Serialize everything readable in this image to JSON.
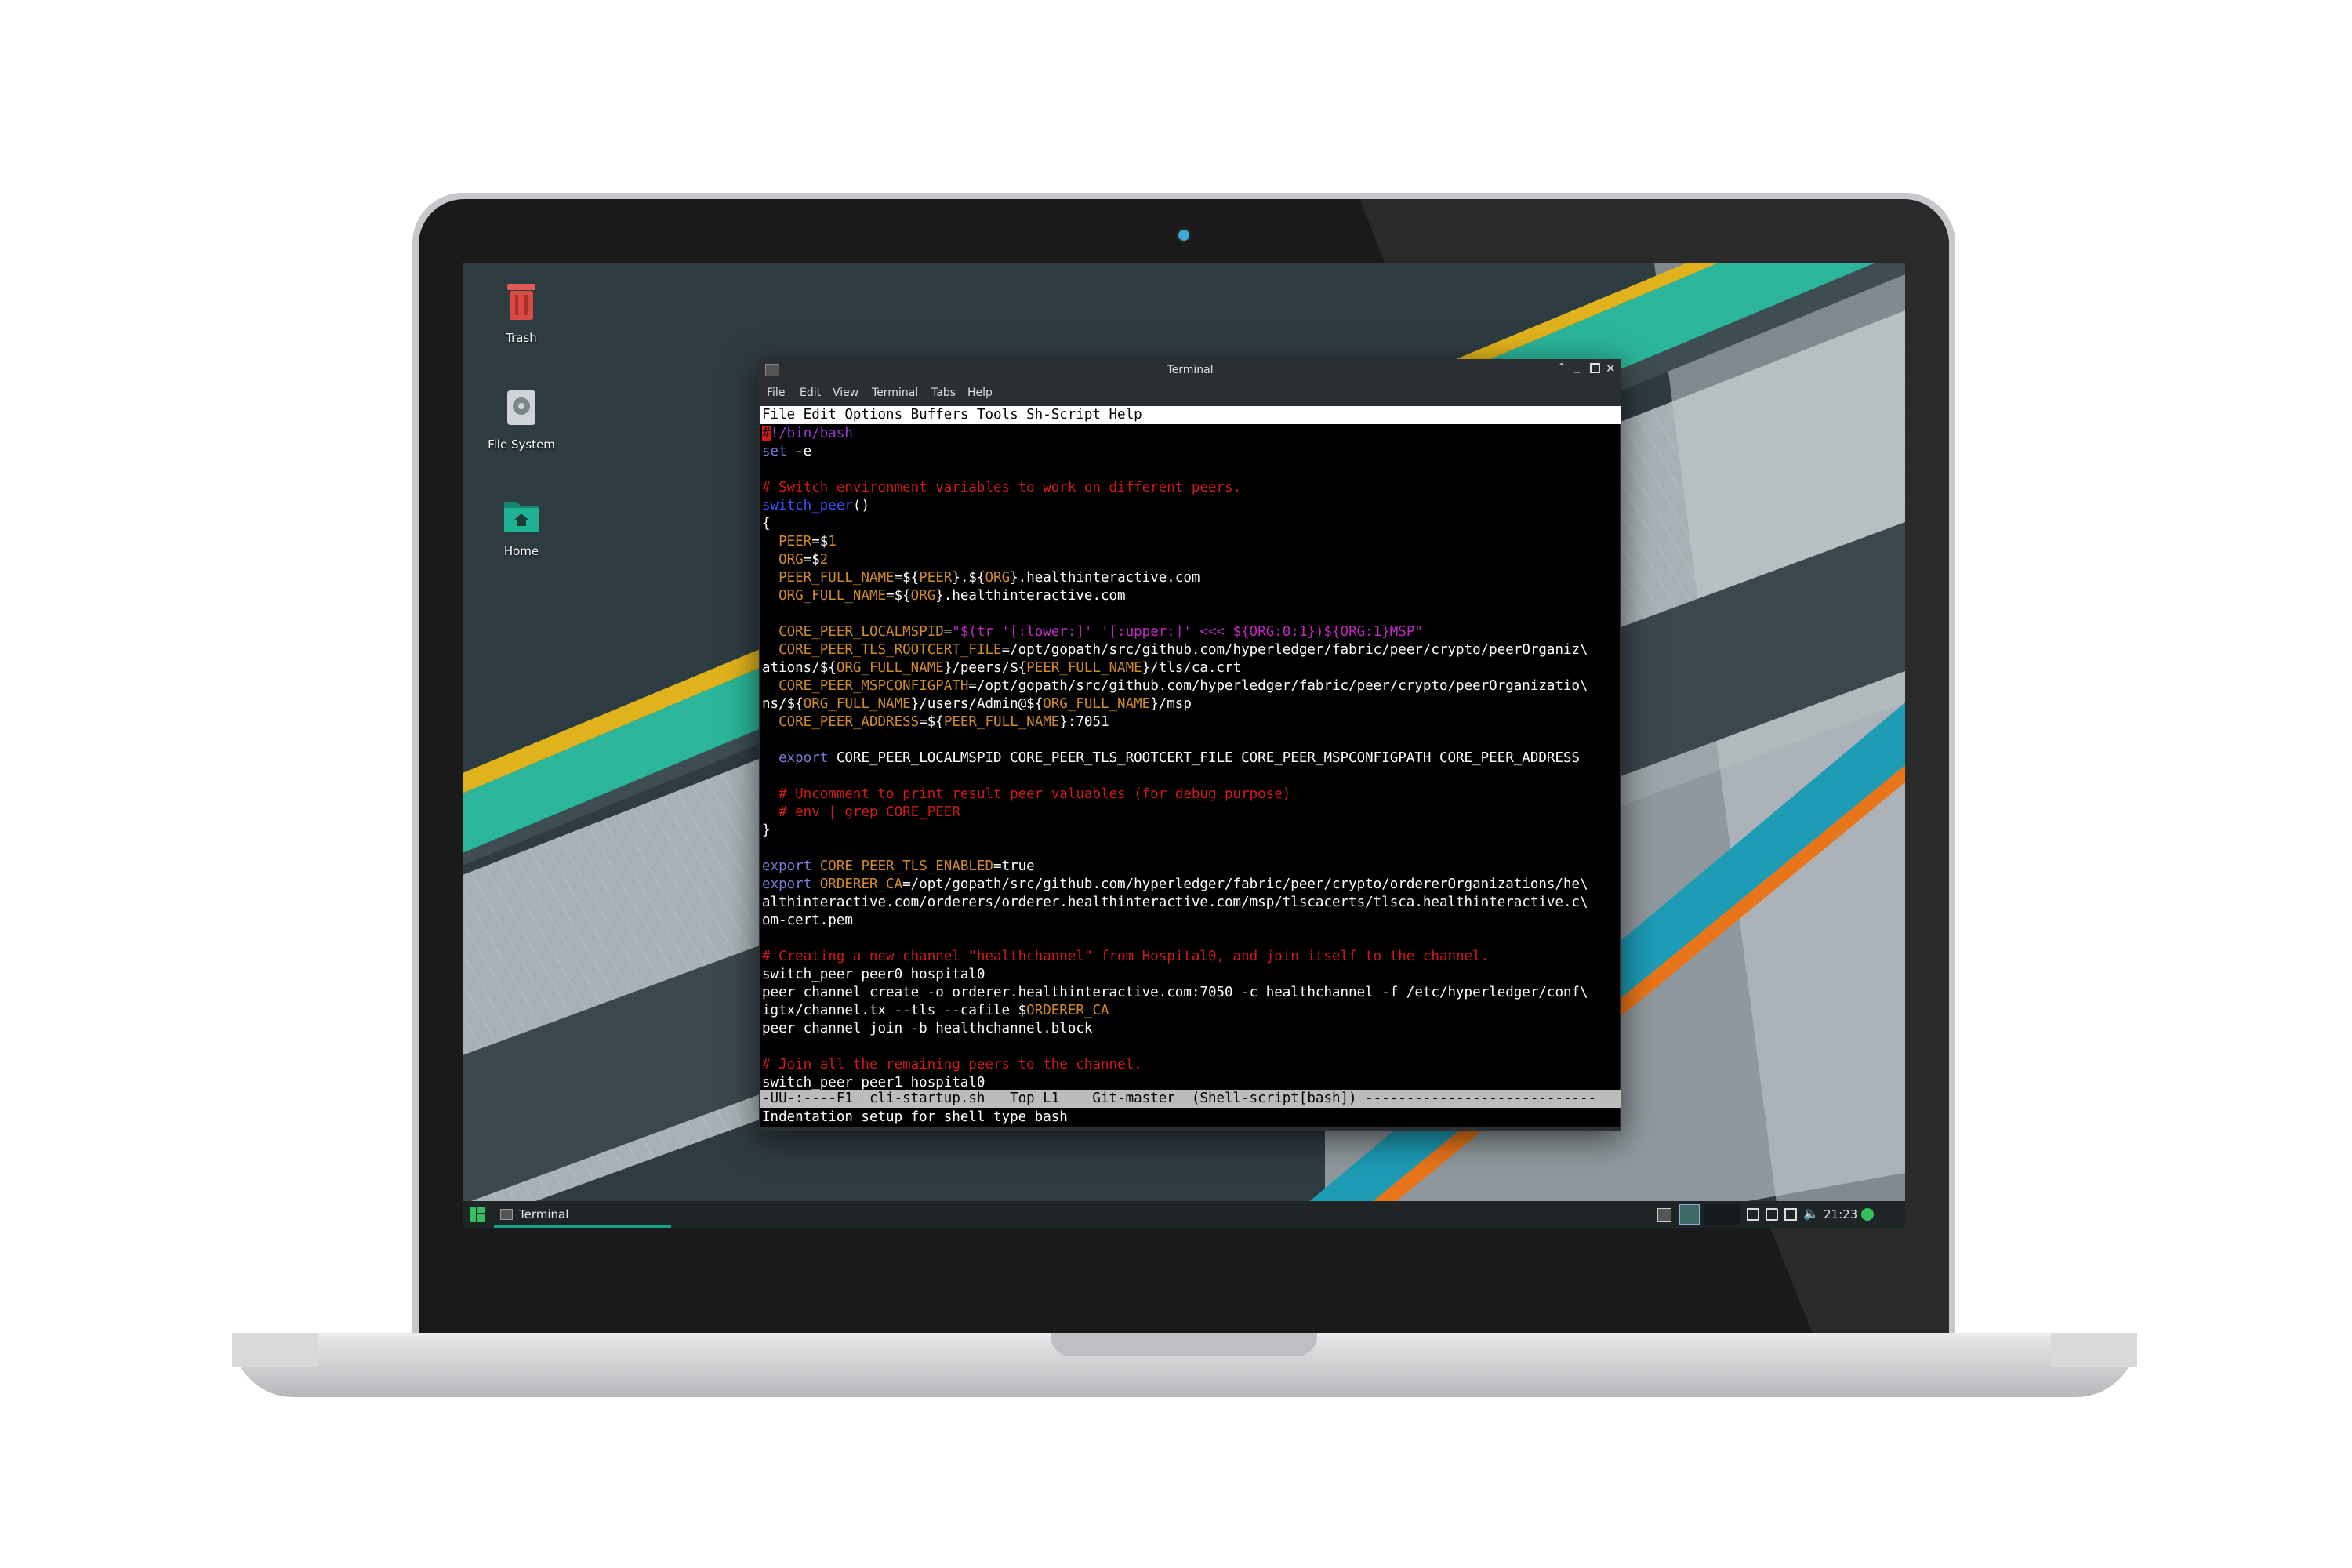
{
  "desktop": {
    "icons": [
      {
        "label": "Trash",
        "icon": "trash-icon"
      },
      {
        "label": "File System",
        "icon": "drive-icon"
      },
      {
        "label": "Home",
        "icon": "home-folder-icon"
      }
    ]
  },
  "terminal": {
    "title": "Terminal",
    "menu": [
      "File",
      "Edit",
      "View",
      "Terminal",
      "Tabs",
      "Help"
    ],
    "controls": [
      "chevron-up-icon",
      "minimize-icon",
      "maximize-icon",
      "close-icon"
    ]
  },
  "emacs": {
    "menubar": "File Edit Options Buffers Tools Sh-Script Help",
    "lines": [
      {
        "t": "!/bin/bash",
        "c": "shebang",
        "cursor": "#"
      },
      {
        "t": "set -e",
        "segs": [
          [
            "set",
            "kw"
          ],
          [
            " -e",
            ""
          ]
        ]
      },
      {
        "t": ""
      },
      {
        "t": "# Switch environment variables to work on different peers.",
        "c": "comment"
      },
      {
        "segs": [
          [
            "switch_peer",
            "fn"
          ],
          [
            "()",
            ""
          ]
        ]
      },
      {
        "t": "{"
      },
      {
        "segs": [
          [
            "  ",
            ""
          ],
          [
            "PEER",
            "var"
          ],
          [
            "=$",
            ""
          ],
          [
            "1",
            "var"
          ]
        ]
      },
      {
        "segs": [
          [
            "  ",
            ""
          ],
          [
            "ORG",
            "var"
          ],
          [
            "=$",
            ""
          ],
          [
            "2",
            "var"
          ]
        ]
      },
      {
        "segs": [
          [
            "  ",
            ""
          ],
          [
            "PEER_FULL_NAME",
            "var"
          ],
          [
            "=${",
            ""
          ],
          [
            "PEER",
            "var"
          ],
          [
            "}.${",
            ""
          ],
          [
            "ORG",
            "var"
          ],
          [
            "}.healthinteractive.com",
            ""
          ]
        ]
      },
      {
        "segs": [
          [
            "  ",
            ""
          ],
          [
            "ORG_FULL_NAME",
            "var"
          ],
          [
            "=${",
            ""
          ],
          [
            "ORG",
            "var"
          ],
          [
            "}.healthinteractive.com",
            ""
          ]
        ]
      },
      {
        "t": ""
      },
      {
        "segs": [
          [
            "  ",
            ""
          ],
          [
            "CORE_PEER_LOCALMSPID",
            "var"
          ],
          [
            "=",
            ""
          ],
          [
            "\"$(tr '[:lower:]' '[:upper:]' <<< ${ORG:0:1})${ORG:1}MSP\"",
            "str"
          ]
        ]
      },
      {
        "segs": [
          [
            "  ",
            ""
          ],
          [
            "CORE_PEER_TLS_ROOTCERT_FILE",
            "var"
          ],
          [
            "=/opt/gopath/src/github.com/hyperledger/fabric/peer/crypto/peerOrganiz\\",
            ""
          ]
        ]
      },
      {
        "segs": [
          [
            "ations/${",
            ""
          ],
          [
            "ORG_FULL_NAME",
            "var"
          ],
          [
            "}/peers/${",
            ""
          ],
          [
            "PEER_FULL_NAME",
            "var"
          ],
          [
            "}/tls/ca.crt",
            ""
          ]
        ]
      },
      {
        "segs": [
          [
            "  ",
            ""
          ],
          [
            "CORE_PEER_MSPCONFIGPATH",
            "var"
          ],
          [
            "=/opt/gopath/src/github.com/hyperledger/fabric/peer/crypto/peerOrganizatio\\",
            ""
          ]
        ]
      },
      {
        "segs": [
          [
            "ns/${",
            ""
          ],
          [
            "ORG_FULL_NAME",
            "var"
          ],
          [
            "}/users/Admin@${",
            ""
          ],
          [
            "ORG_FULL_NAME",
            "var"
          ],
          [
            "}/msp",
            ""
          ]
        ]
      },
      {
        "segs": [
          [
            "  ",
            ""
          ],
          [
            "CORE_PEER_ADDRESS",
            "var"
          ],
          [
            "=${",
            ""
          ],
          [
            "PEER_FULL_NAME",
            "var"
          ],
          [
            "}:7051",
            ""
          ]
        ]
      },
      {
        "t": ""
      },
      {
        "segs": [
          [
            "  ",
            ""
          ],
          [
            "export",
            "kw"
          ],
          [
            " CORE_PEER_LOCALMSPID CORE_PEER_TLS_ROOTCERT_FILE CORE_PEER_MSPCONFIGPATH CORE_PEER_ADDRESS",
            ""
          ]
        ]
      },
      {
        "t": ""
      },
      {
        "t": "  # Uncomment to print result peer valuables (for debug purpose)",
        "c": "comment"
      },
      {
        "t": "  # env | grep CORE_PEER",
        "c": "comment"
      },
      {
        "t": "}"
      },
      {
        "t": ""
      },
      {
        "segs": [
          [
            "export",
            "kw"
          ],
          [
            " ",
            ""
          ],
          [
            "CORE_PEER_TLS_ENABLED",
            "var"
          ],
          [
            "=true",
            ""
          ]
        ]
      },
      {
        "segs": [
          [
            "export",
            "kw"
          ],
          [
            " ",
            ""
          ],
          [
            "ORDERER_CA",
            "var"
          ],
          [
            "=/opt/gopath/src/github.com/hyperledger/fabric/peer/crypto/ordererOrganizations/he\\",
            ""
          ]
        ]
      },
      {
        "t": "althinteractive.com/orderers/orderer.healthinteractive.com/msp/tlscacerts/tlsca.healthinteractive.c\\"
      },
      {
        "t": "om-cert.pem"
      },
      {
        "t": ""
      },
      {
        "t": "# Creating a new channel \"healthchannel\" from Hospital0, and join itself to the channel.",
        "c": "comment"
      },
      {
        "t": "switch_peer peer0 hospital0"
      },
      {
        "t": "peer channel create -o orderer.healthinteractive.com:7050 -c healthchannel -f /etc/hyperledger/conf\\"
      },
      {
        "segs": [
          [
            "igtx/channel.tx --tls --cafile $",
            ""
          ],
          [
            "ORDERER_CA",
            "var"
          ]
        ]
      },
      {
        "t": "peer channel join -b healthchannel.block"
      },
      {
        "t": ""
      },
      {
        "t": "# Join all the remaining peers to the channel.",
        "c": "comment"
      },
      {
        "t": "switch_peer peer1 hospital0"
      }
    ],
    "modeline": "-UU-:----F1  cli-startup.sh   Top L1    Git-master  (Shell-script[bash]) ----------------------------",
    "echo": "Indentation setup for shell type bash"
  },
  "taskbar": {
    "task_label": "Terminal",
    "clock": "21:23"
  },
  "colors": {
    "accent": "#16a085",
    "desktop_bg": "#2e3b40",
    "stripe_yellow": "#e0b21b",
    "stripe_teal": "#2bb59a",
    "stripe_blue": "#1e9bb5",
    "stripe_orange": "#e8751a"
  }
}
